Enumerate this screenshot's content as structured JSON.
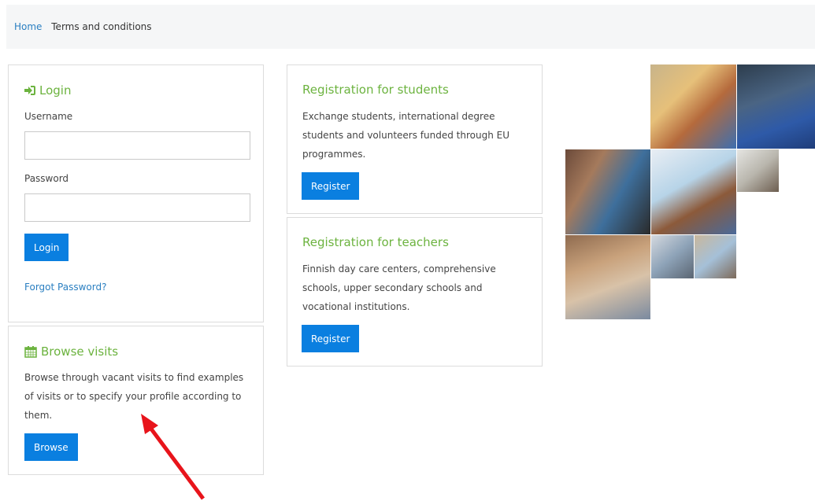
{
  "breadcrumb": {
    "home": "Home",
    "current": "Terms and conditions"
  },
  "login": {
    "title": "Login",
    "username_label": "Username",
    "username_value": "",
    "password_label": "Password",
    "password_value": "",
    "button": "Login",
    "forgot": "Forgot Password?"
  },
  "browse": {
    "title": "Browse visits",
    "description": "Browse through vacant visits to find examples of visits or to specify your profile according to them.",
    "button": "Browse"
  },
  "students": {
    "title": "Registration for students",
    "description": "Exchange students, international degree students and volunteers funded through EU programmes.",
    "button": "Register"
  },
  "teachers": {
    "title": "Registration for teachers",
    "description": "Finnish day care centers, comprehensive schools, upper secondary schools and vocational institutions.",
    "button": "Register"
  },
  "colors": {
    "accent_green": "#6cb33f",
    "button_blue": "#0a7fe0",
    "link_blue": "#2a7fc1",
    "annotation_red": "#e8141b"
  },
  "icons": {
    "login": "sign-in-icon",
    "browse": "calendar-icon"
  }
}
